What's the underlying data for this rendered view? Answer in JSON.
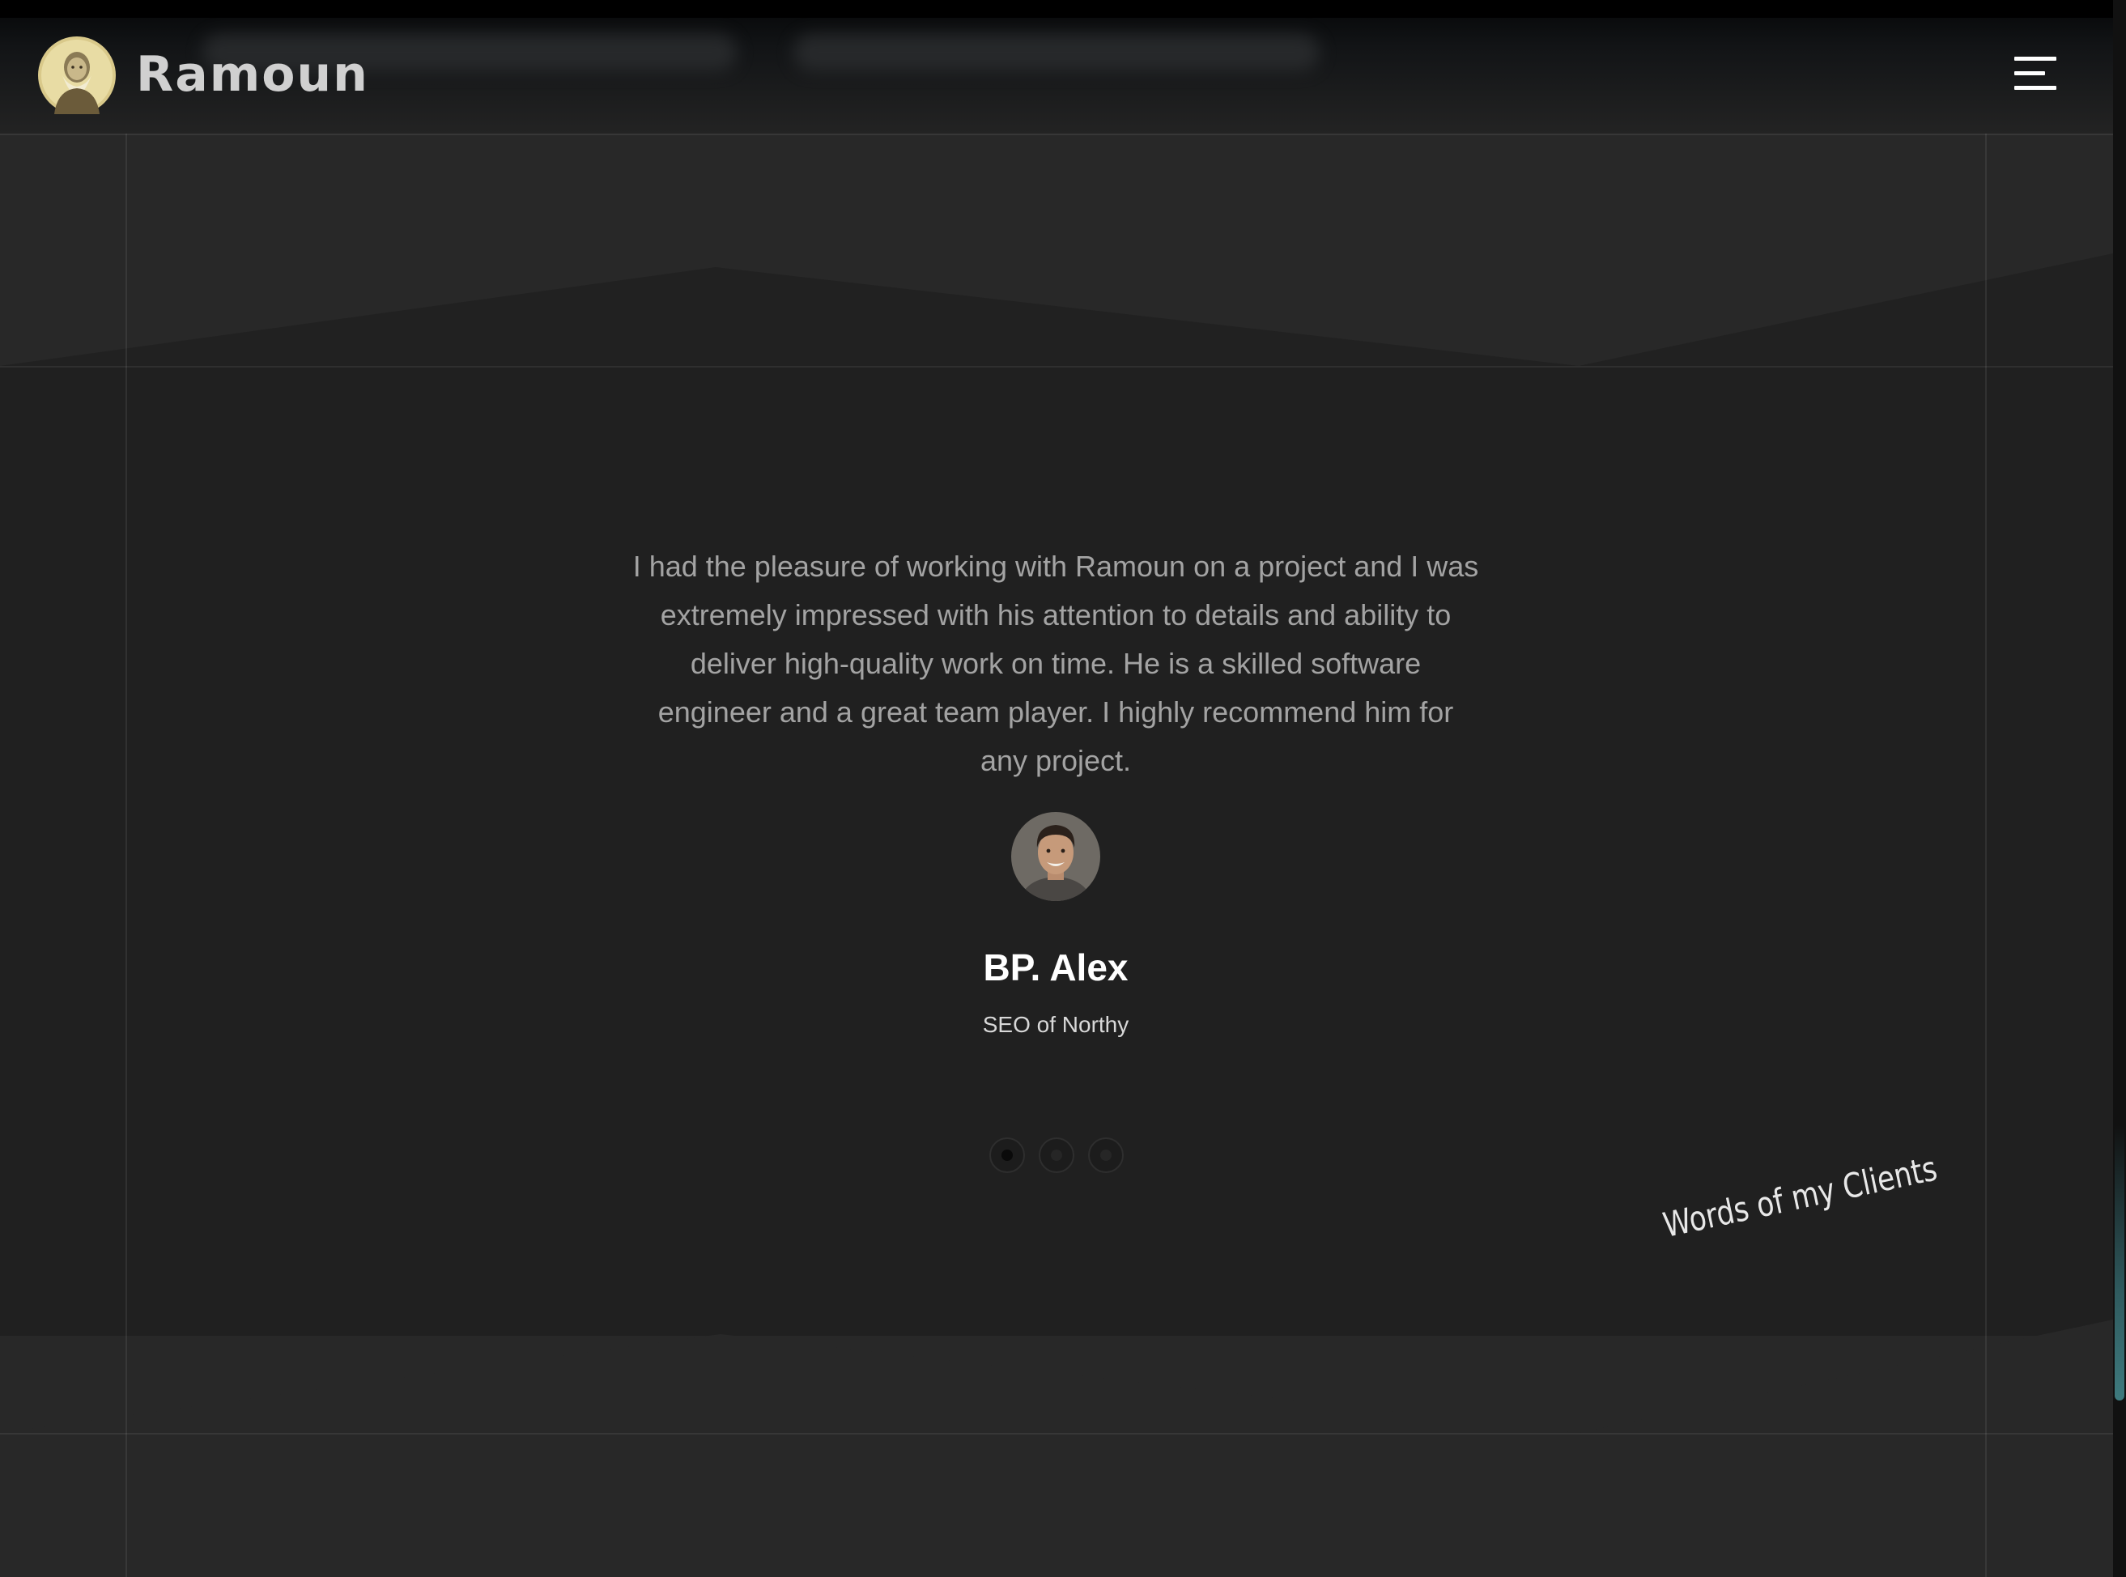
{
  "brand": {
    "name": "Ramoun",
    "logo_icon": "bearded-man-portrait"
  },
  "header": {
    "menu_icon": "hamburger-menu-icon"
  },
  "testimonial": {
    "quote": "I had the pleasure of working with Ramoun on a project and I was extremely impressed with his attention to details and ability to deliver high-quality work on time. He is a skilled software engineer and a great team player. I highly recommend him for any project.",
    "client_name": "BP. Alex",
    "client_role": "SEO of Northy",
    "client_avatar_icon": "client-portrait"
  },
  "carousel": {
    "total_slides": 3,
    "active_index": 0
  },
  "section": {
    "label": "Words of my Clients"
  },
  "colors": {
    "background": "#202020",
    "band": "#282828",
    "text_muted": "#a3a3a3",
    "text_bright": "#ffffff",
    "scroll_accent": "#3e7a7e"
  }
}
